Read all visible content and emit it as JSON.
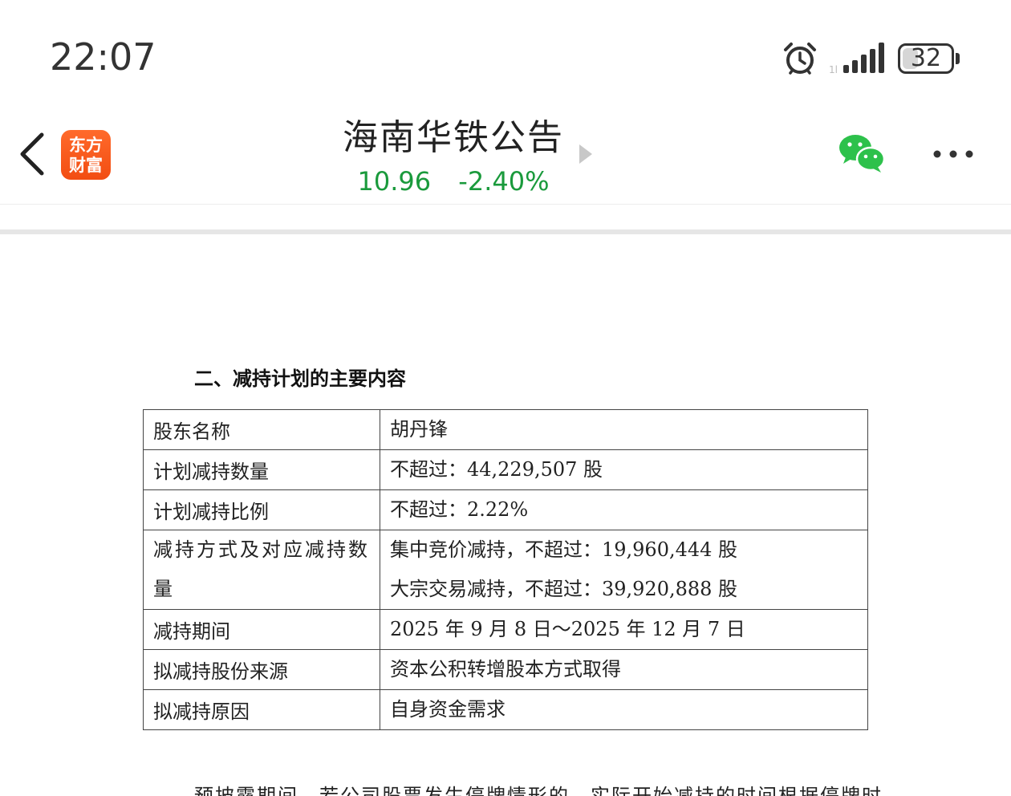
{
  "status_bar": {
    "time": "22:07",
    "battery_level": "32",
    "battery_fraction": 0.32,
    "icons": [
      "alarm-icon",
      "signal-icon",
      "battery-icon"
    ]
  },
  "nav": {
    "logo_line1": "东方",
    "logo_line2": "财富",
    "stock_name": "海南华铁公告",
    "price": "10.96",
    "change": "-2.40%",
    "price_color": "#1a9a3c",
    "logo_color": "#f24d12",
    "wechat_color": "#2dc14b"
  },
  "doc": {
    "section_title": "二、减持计划的主要内容",
    "table": {
      "rows": [
        {
          "key": "股东名称",
          "values": [
            "胡丹锋"
          ]
        },
        {
          "key": "计划减持数量",
          "values": [
            "不超过：44,229,507 股"
          ]
        },
        {
          "key": "计划减持比例",
          "values": [
            "不超过：2.22%"
          ]
        },
        {
          "key": "减持方式及对应减持数量",
          "values": [
            "集中竞价减持，不超过：19,960,444 股",
            "大宗交易减持，不超过：39,920,888 股"
          ]
        },
        {
          "key": "减持期间",
          "values": [
            "2025 年 9 月 8 日～2025 年 12 月 7 日"
          ]
        },
        {
          "key": "拟减持股份来源",
          "values": [
            "资本公积转增股本方式取得"
          ]
        },
        {
          "key": "拟减持原因",
          "values": [
            "自身资金需求"
          ]
        }
      ]
    },
    "bottom_text": "预披露期间，若公司股票发生停牌情形的，实际开始减持的时间根据停牌时"
  }
}
